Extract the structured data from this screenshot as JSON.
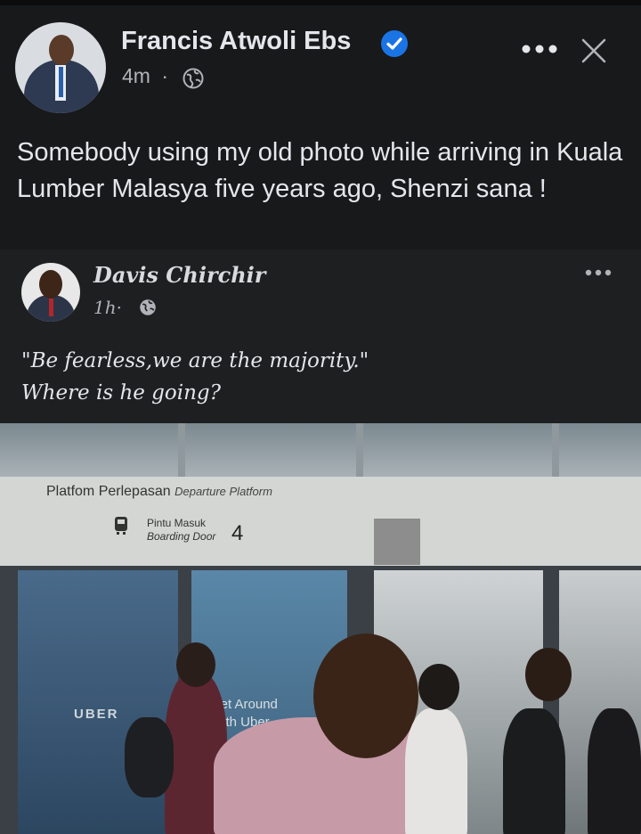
{
  "post": {
    "author": "Francis Atwoli Ebs",
    "time": "4m",
    "separator": "·",
    "text": "Somebody using my old photo while arriving in Kuala Lumber Malasya five years ago, Shenzi sana !"
  },
  "shared_post": {
    "author": "Davis Chirchir",
    "time": "1h·",
    "quote": "\"Be fearless,we are the majority.\"",
    "caption": "Where is he going?"
  },
  "photo": {
    "sign_line1": "Platfom Perlepasan",
    "sign_line1_en": "Departure Platform",
    "sign_door_ms": "Pintu Masuk",
    "sign_door_en": "Boarding Door",
    "door_number": "4",
    "ad_brand": "UBER",
    "ad_text_1": "Get Around",
    "ad_text_2": "With Uber"
  },
  "icons": {
    "verified": "verified-badge-icon",
    "globe": "globe-icon",
    "more": "more-options-icon",
    "close": "close-icon"
  },
  "colors": {
    "background": "#18191a",
    "verified_blue": "#1b74e4",
    "secondary_text": "#b0b3b8"
  }
}
